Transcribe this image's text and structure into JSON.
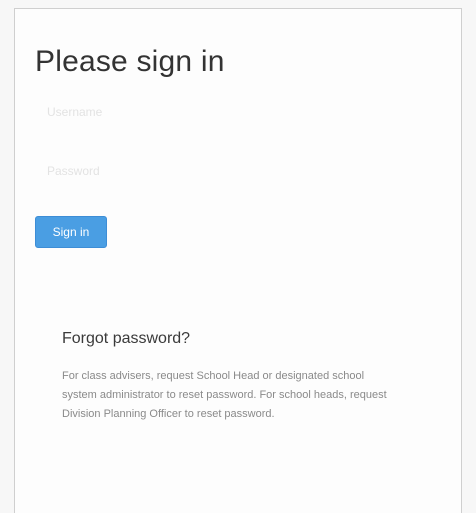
{
  "login": {
    "title": "Please sign in",
    "username_placeholder": "Username",
    "password_placeholder": "Password",
    "signin_label": "Sign in"
  },
  "help": {
    "title": "Forgot password?",
    "text": "For class advisers, request School Head or designated school system administrator to reset password. For school heads, request Division Planning Officer to reset password."
  },
  "colors": {
    "button_bg": "#4a9ee3",
    "title_text": "#333333",
    "help_text": "#8a8a8a"
  }
}
